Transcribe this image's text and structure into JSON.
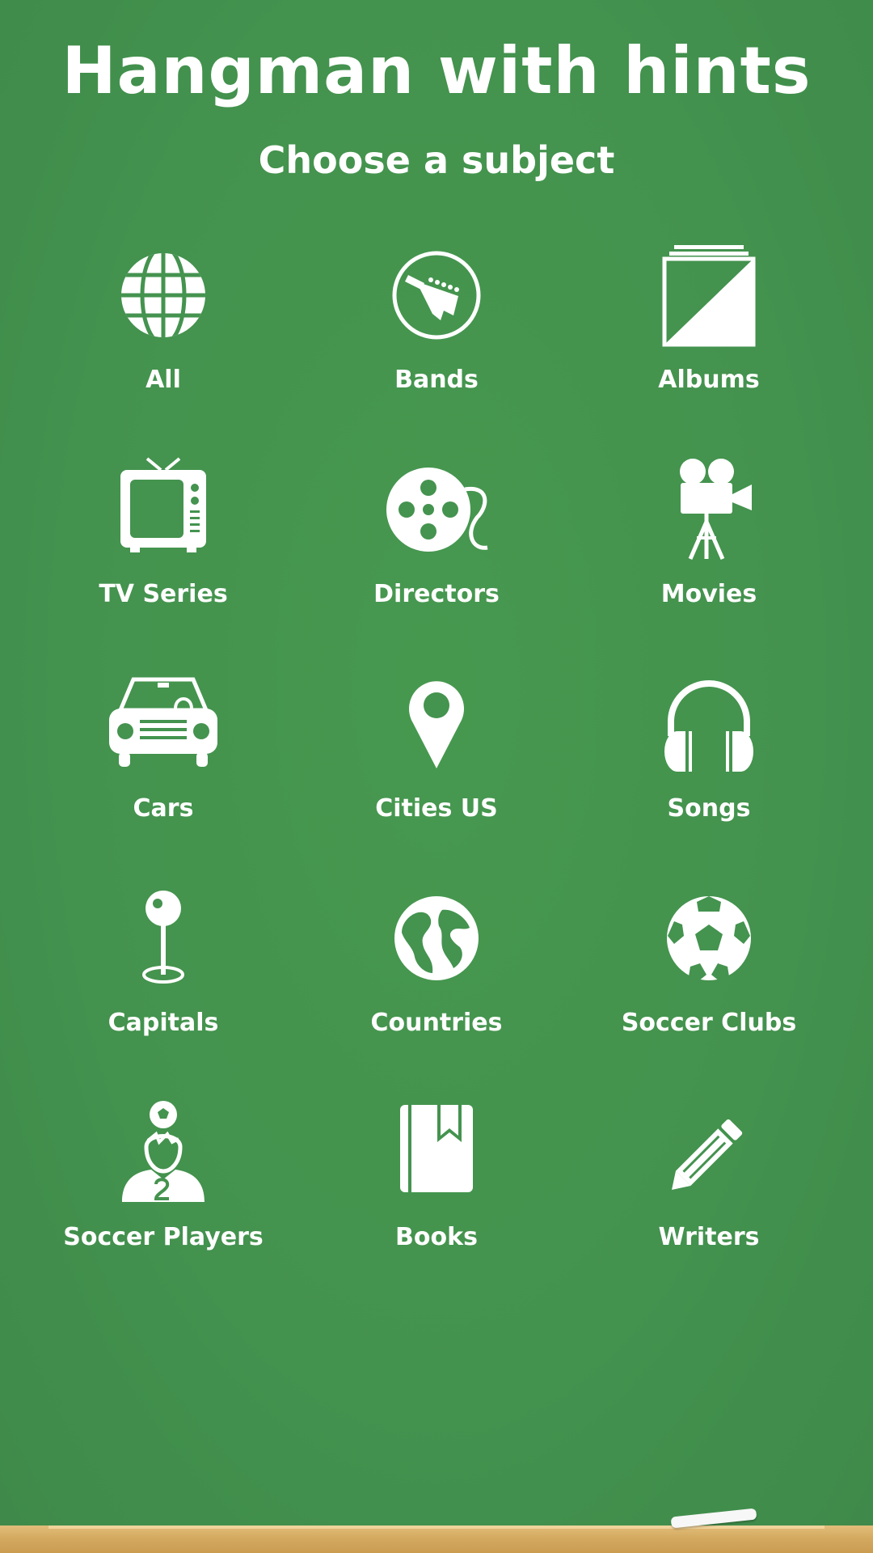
{
  "title": "Hangman with hints",
  "subtitle": "Choose a subject",
  "colors": {
    "board": "#44934f",
    "text": "#ffffff",
    "ledge": "#d4aa60"
  },
  "subjects": [
    {
      "label": "All",
      "icon": "globe-grid-icon"
    },
    {
      "label": "Bands",
      "icon": "guitar-icon"
    },
    {
      "label": "Albums",
      "icon": "album-stack-icon"
    },
    {
      "label": "TV Series",
      "icon": "tv-icon"
    },
    {
      "label": "Directors",
      "icon": "film-reel-icon"
    },
    {
      "label": "Movies",
      "icon": "movie-camera-icon"
    },
    {
      "label": "Cars",
      "icon": "car-icon"
    },
    {
      "label": "Cities US",
      "icon": "map-pin-icon"
    },
    {
      "label": "Songs",
      "icon": "headphones-icon"
    },
    {
      "label": "Capitals",
      "icon": "location-pushpin-icon"
    },
    {
      "label": "Countries",
      "icon": "earth-icon"
    },
    {
      "label": "Soccer Clubs",
      "icon": "soccer-ball-icon"
    },
    {
      "label": "Soccer Players",
      "icon": "soccer-player-icon"
    },
    {
      "label": "Books",
      "icon": "book-icon"
    },
    {
      "label": "Writers",
      "icon": "pencil-icon"
    }
  ]
}
